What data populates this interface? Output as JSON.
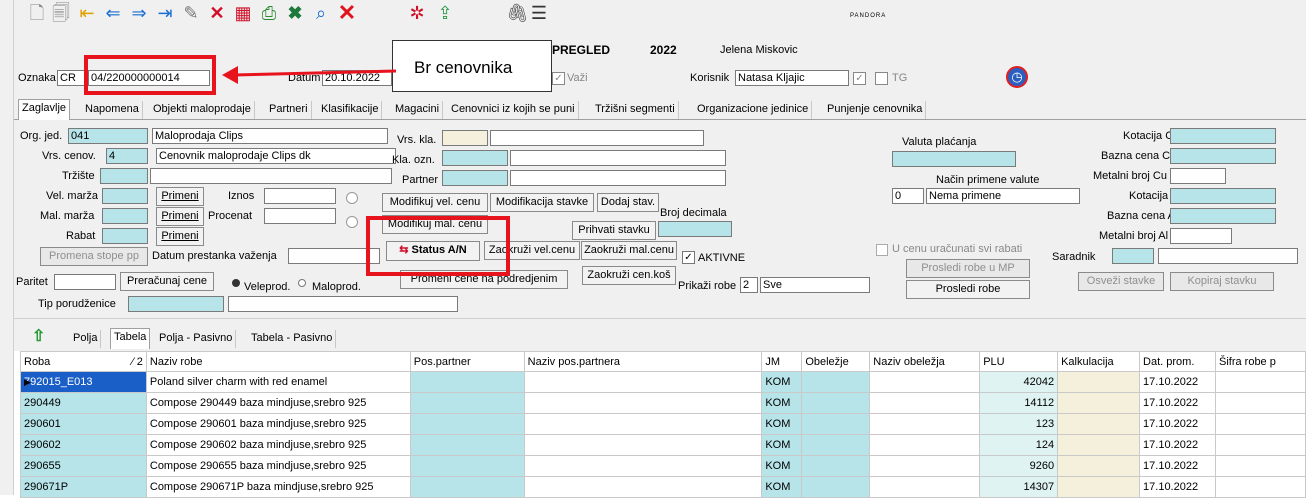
{
  "header": {
    "view_title": "PREGLED",
    "year": "2022",
    "user_name": "Jelena Miskovic",
    "logo": "PANDORA"
  },
  "annotation": {
    "callout_text": "Br cenovnika"
  },
  "top_fields": {
    "oznaka_label": "Oznaka",
    "oznaka_value": "CR",
    "number_value": "04/220000000014",
    "datum_label": "Datum",
    "datum_value": "20.10.2022",
    "vazi_label": "Važi",
    "korisnik_label": "Korisnik",
    "korisnik_value": "Natasa Kljajic",
    "tg_label": "TG"
  },
  "tabs": [
    "Zaglavlje",
    "Napomena",
    "Objekti maloprodaje",
    "Partneri",
    "Klasifikacije",
    "Magacini",
    "Cenovnici iz kojih se puni",
    "Tržišni segmenti",
    "Organizacione jedinice",
    "Punjenje cenovnika"
  ],
  "form": {
    "org_jed_label": "Org. jed.",
    "org_jed_code": "041",
    "org_jed_name": "Maloprodaja Clips",
    "vrs_cenov_label": "Vrs. cenov.",
    "vrs_cenov_code": "4",
    "vrs_cenov_name": "Cenovnik maloprodaje Clips dk",
    "trziste_label": "Tržište",
    "vel_marza_label": "Vel. marža",
    "mal_marza_label": "Mal. marža",
    "rabat_label": "Rabat",
    "primeni_label": "Primeni",
    "iznos_label": "Iznos",
    "procenat_label": "Procenat",
    "promena_stope_label": "Promena stope pp",
    "datum_prestanka_label": "Datum prestanka važenja",
    "paritet_label": "Paritet",
    "preracunaj_label": "Preračunaj cene",
    "veleprod_label": "Veleprod.",
    "maloprod_label": "Maloprod.",
    "tip_porudzbenice_label": "Tip porudženice",
    "vrs_kla_label": "Vrs. kla.",
    "kla_ozn_label": "Kla. ozn.",
    "partner_label": "Partner",
    "modifikuj_vel_label": "Modifikuj vel. cenu",
    "modifikacija_stavke_label": "Modifikacija stavke",
    "dodaj_stav_label": "Dodaj stav.",
    "broj_decimala_label": "Broj decimala",
    "modifikuj_mal_label": "Modifikuj mal. cenu",
    "prihvati_stavku_label": "Prihvati stavku",
    "status_label": "Status A/N",
    "zaokruzi_vel_label": "Zaokruži vel.cenu",
    "zaokruzi_mal_label": "Zaokruži mal.cenu",
    "aktivne_label": "AKTIVNE",
    "promeni_cene_label": "Promeni cene na podredjenim",
    "zaokruzi_kos_label": "Zaokruži cen.koš",
    "prikazi_robe_label": "Prikaži robe",
    "prikazi_robe_code": "2",
    "prikazi_robe_value": "Sve",
    "valuta_label": "Valuta plaćanja",
    "nacin_label": "Način primene valute",
    "nacin_code": "0",
    "nacin_value": "Nema primene",
    "u_cenu_label": "U cenu uračunati svi rabati",
    "prosledi_mp_label": "Prosledi robe u MP",
    "prosledi_label": "Prosledi robe",
    "saradnik_label": "Saradnik",
    "kotacija_cu_label": "Kotacija Cu",
    "bazna_cu_label": "Bazna cena Cu",
    "metalni_cu_label": "Metalni broj Cu",
    "kotacija_al_label": "Kotacija Al",
    "bazna_al_label": "Bazna cena Al",
    "metalni_al_label": "Metalni broj Al",
    "osvezi_label": "Osveži stavke",
    "kopiraj_label": "Kopiraj stavku"
  },
  "sub_tabs": [
    "Polja",
    "Tabela",
    "Polja - Pasivno",
    "Tabela - Pasivno"
  ],
  "table": {
    "sort_indicator": "⁄ 2",
    "columns": [
      "Roba",
      "Naziv robe",
      "Pos.partner",
      "Naziv pos.partnera",
      "JM",
      "Obeležje",
      "Naziv obeležja",
      "PLU",
      "Kalkulacija",
      "Dat. prom.",
      "Šifra robe p"
    ],
    "rows": [
      {
        "roba": "792015_E013",
        "naziv": "Poland silver charm with red enamel",
        "jm": "KOM",
        "plu": "42042",
        "dat": "17.10.2022"
      },
      {
        "roba": "290449",
        "naziv": "Compose 290449 baza mindjuse,srebro 925",
        "jm": "KOM",
        "plu": "14112",
        "dat": "17.10.2022"
      },
      {
        "roba": "290601",
        "naziv": "Compose 290601 baza mindjuse,srebro 925",
        "jm": "KOM",
        "plu": "123",
        "dat": "17.10.2022"
      },
      {
        "roba": "290602",
        "naziv": "Compose 290602 baza mindjuse,srebro 925",
        "jm": "KOM",
        "plu": "124",
        "dat": "17.10.2022"
      },
      {
        "roba": "290655",
        "naziv": "Compose 290655 baza mindjuse,srebro 925",
        "jm": "KOM",
        "plu": "9260",
        "dat": "17.10.2022"
      },
      {
        "roba": "290671P",
        "naziv": "Compose 290671P baza mindjuse,srebro 925",
        "jm": "KOM",
        "plu": "14307",
        "dat": "17.10.2022"
      }
    ]
  },
  "colors": {
    "accent_red": "#e8141d",
    "field_cyan": "#b6e4e9",
    "panel": "#f0f0f0"
  }
}
